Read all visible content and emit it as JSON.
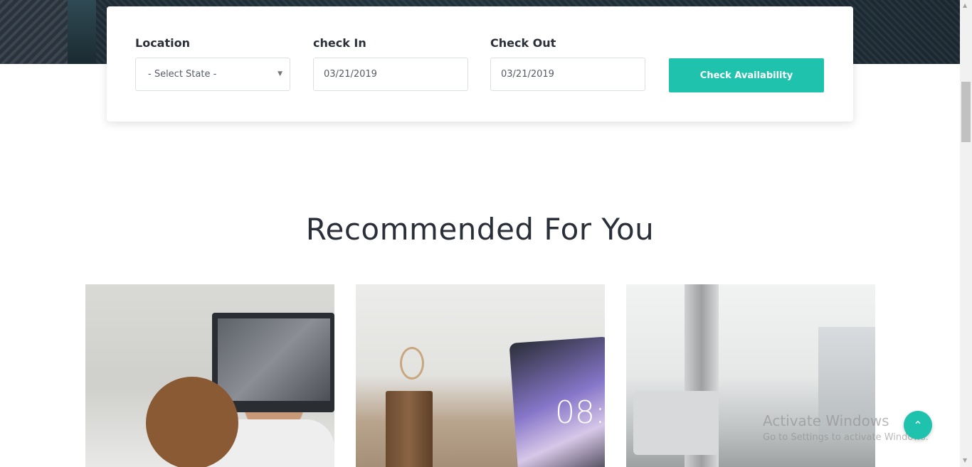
{
  "search": {
    "location_label": "Location",
    "location_placeholder": "- Select State -",
    "checkin_label": "check In",
    "checkin_value": "03/21/2019",
    "checkout_label": "Check Out",
    "checkout_value": "03/21/2019",
    "button_label": "Check Availability"
  },
  "section": {
    "title": "Recommended For You"
  },
  "cards": [
    {
      "image": "man-laughing-at-computer"
    },
    {
      "image": "desk-pencil-holder-and-tablet",
      "clock_text": "08:"
    },
    {
      "image": "blurred-office-with-imac"
    }
  ],
  "watermark": {
    "line1": "Activate Windows",
    "line2": "Go to Settings to activate Windows."
  },
  "scroll_top": {
    "icon": "chevron-up-icon"
  },
  "colors": {
    "accent": "#1fc2ad",
    "text": "#2b2f3a",
    "hero": "#1f2f38"
  }
}
